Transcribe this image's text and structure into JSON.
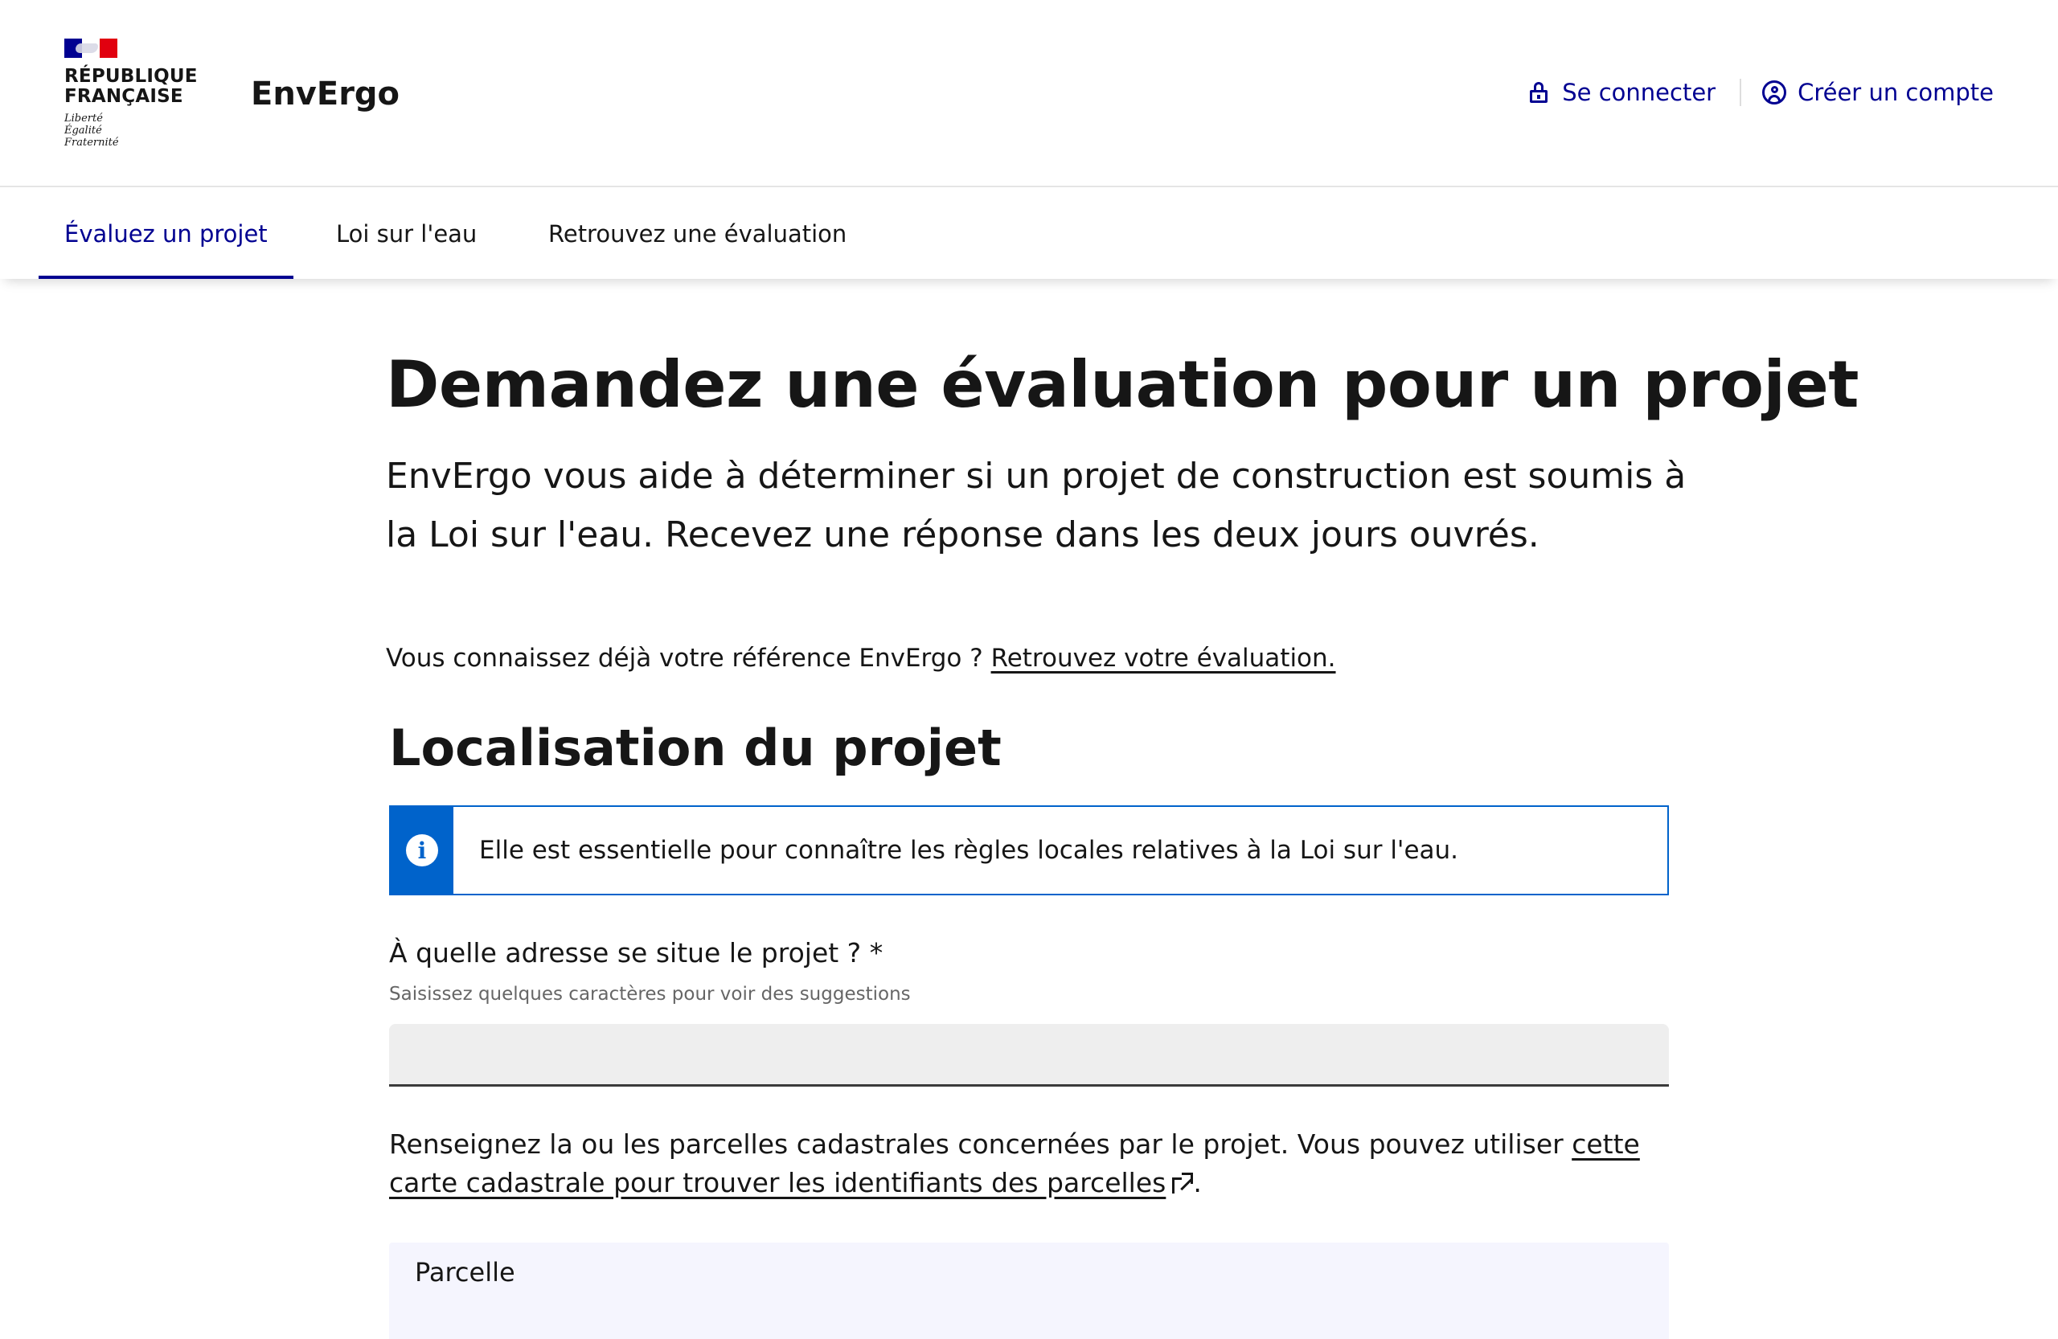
{
  "header": {
    "marianne_line1": "RÉPUBLIQUE",
    "marianne_line2": "FRANÇAISE",
    "devise": [
      "Liberté",
      "Égalité",
      "Fraternité"
    ],
    "site_name": "EnvErgo",
    "quick_links": {
      "login": "Se connecter",
      "create_account": "Créer un compte"
    }
  },
  "nav": {
    "items": [
      {
        "label": "Évaluez un projet",
        "active": true
      },
      {
        "label": "Loi sur l'eau",
        "active": false
      },
      {
        "label": "Retrouvez une évaluation",
        "active": false
      }
    ]
  },
  "main": {
    "title": "Demandez une évaluation pour un projet",
    "lead": "EnvErgo vous aide à déterminer si un projet de construction est soumis à la Loi sur l'eau. Recevez une réponse dans les deux jours ouvrés.",
    "ref_prefix": "Vous connaissez déjà votre référence EnvErgo ? ",
    "ref_link": "Retrouvez votre évaluation.",
    "section_title": "Localisation du projet",
    "notice": "Elle est essentielle pour connaître les règles locales relatives à la Loi sur l'eau.",
    "address_label": "À quelle adresse se situe le projet ? *",
    "address_hint": "Saisissez quelques caractères pour voir des suggestions",
    "address_value": "",
    "parcel_intro": "Renseignez la ou les parcelles cadastrales concernées par le projet. Vous pouvez utiliser ",
    "parcel_link": "cette carte cadastrale pour trouver les identifiants des parcelles",
    "parcel_suffix": ".",
    "parcel_label": "Parcelle"
  },
  "colors": {
    "primary": "#000091",
    "info": "#0063cb",
    "input_bg": "#eeeeee",
    "parcel_bg": "#f5f5fe"
  }
}
